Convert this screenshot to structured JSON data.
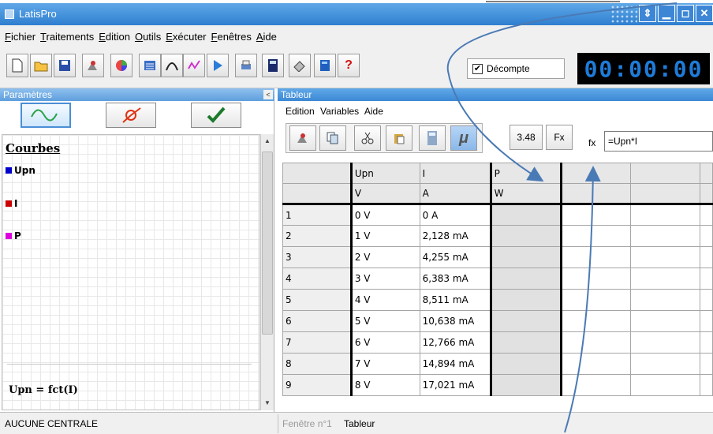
{
  "window": {
    "title": "LatisPro",
    "buttons": [
      "⇕",
      "▁",
      "◻",
      "✕"
    ]
  },
  "menubar": {
    "items": [
      "Fichier",
      "Traitements",
      "Edition",
      "Outils",
      "Exécuter",
      "Fenêtres",
      "Aide"
    ]
  },
  "toolbar": {
    "icons": [
      "new-file-icon",
      "open-folder-icon",
      "save-icon",
      "acquisition-icon",
      "color-wheel-icon",
      "list-icon",
      "curve-icon",
      "modeling-icon",
      "play-icon",
      "printer-icon",
      "calculator-icon",
      "eraser-icon",
      "book-icon",
      "help-icon"
    ],
    "decompte_label": "Décompte",
    "decompte_checked": true,
    "timer": "00:00:00",
    "timer_color": "#1e7bd8"
  },
  "params": {
    "title": "Paramètres",
    "close": "<",
    "heading": "Courbes",
    "curves": [
      {
        "name": "Upn",
        "color": "#0000cc"
      },
      {
        "name": "I",
        "color": "#cc0000"
      },
      {
        "name": "P",
        "color": "#dd00dd"
      }
    ],
    "formula": "Upn = fct(I)"
  },
  "tableur": {
    "title": "Tableur",
    "menu": [
      "Edition",
      "Variables",
      "Aide"
    ],
    "digits_label": "3.48",
    "fx_button": "Fx",
    "fx_label": "fx",
    "formula_value": "=Upn*I",
    "columns": [
      "Upn",
      "I",
      "P",
      "",
      "",
      ""
    ],
    "units": [
      "V",
      "A",
      "W",
      "",
      "",
      ""
    ],
    "rows": [
      {
        "n": "1",
        "upn": "0 V",
        "i": "0 A"
      },
      {
        "n": "2",
        "upn": "1 V",
        "i": "2,128 mA"
      },
      {
        "n": "3",
        "upn": "2 V",
        "i": "4,255 mA"
      },
      {
        "n": "4",
        "upn": "3 V",
        "i": "6,383 mA"
      },
      {
        "n": "5",
        "upn": "4 V",
        "i": "8,511 mA"
      },
      {
        "n": "6",
        "upn": "5 V",
        "i": "10,638 mA"
      },
      {
        "n": "7",
        "upn": "6 V",
        "i": "12,766 mA"
      },
      {
        "n": "8",
        "upn": "7 V",
        "i": "14,894 mA"
      },
      {
        "n": "9",
        "upn": "8 V",
        "i": "17,021 mA"
      }
    ]
  },
  "status": {
    "left": "AUCUNE CENTRALE",
    "tab1": "Fenêtre n°1",
    "tab2": "Tableur"
  },
  "annotation_color": "#4a7ab5"
}
